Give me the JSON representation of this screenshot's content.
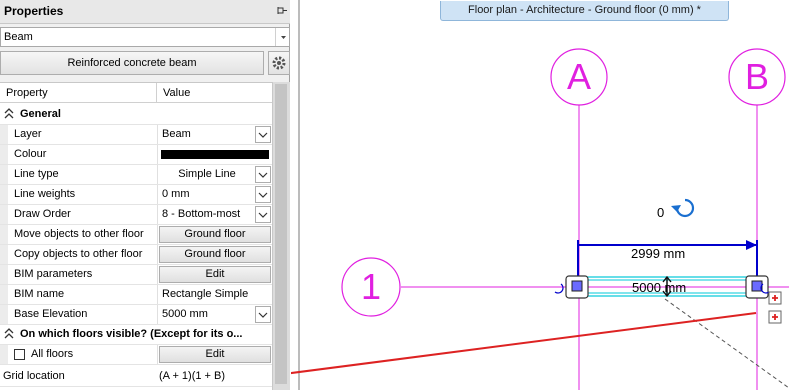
{
  "panel": {
    "title": "Properties",
    "type_selector": "Beam",
    "style_button": "Reinforced concrete beam",
    "columns": {
      "property": "Property",
      "value": "Value"
    },
    "sections": {
      "general": "General",
      "visibility": "On which floors visible? (Except for its o..."
    },
    "rows": [
      {
        "name": "Layer",
        "value": "Beam"
      },
      {
        "name": "Colour",
        "value": ""
      },
      {
        "name": "Line type",
        "value": "Simple Line"
      },
      {
        "name": "Line weights",
        "value": "0 mm"
      },
      {
        "name": "Draw Order",
        "value": "8 - Bottom-most"
      },
      {
        "name": "Move objects to other floor",
        "value": "Ground floor"
      },
      {
        "name": "Copy objects to other floor",
        "value": "Ground floor"
      },
      {
        "name": "BIM parameters",
        "value": "Edit"
      },
      {
        "name": "BIM name",
        "value": "Rectangle Simple"
      },
      {
        "name": "Base Elevation",
        "value": "5000 mm"
      }
    ],
    "all_floors": {
      "name": "All floors",
      "value": "Edit",
      "checked": false
    },
    "grid_location": {
      "name": "Grid location",
      "value": "(A + 1)(1 + B)"
    },
    "colour_value": "#000000"
  },
  "view": {
    "tab_title": "Floor plan - Architecture - Ground floor (0 mm) *",
    "grid_labels": {
      "a": "A",
      "b": "B",
      "one": "1"
    },
    "rotation_label": "0",
    "dimension_length": "2999 mm",
    "beam_label": "5000 mm",
    "grid_color": "#e020e0",
    "dimension_color": "#0000cc",
    "beam_color": "#00c8d8",
    "arrow_color": "#dd2222"
  }
}
